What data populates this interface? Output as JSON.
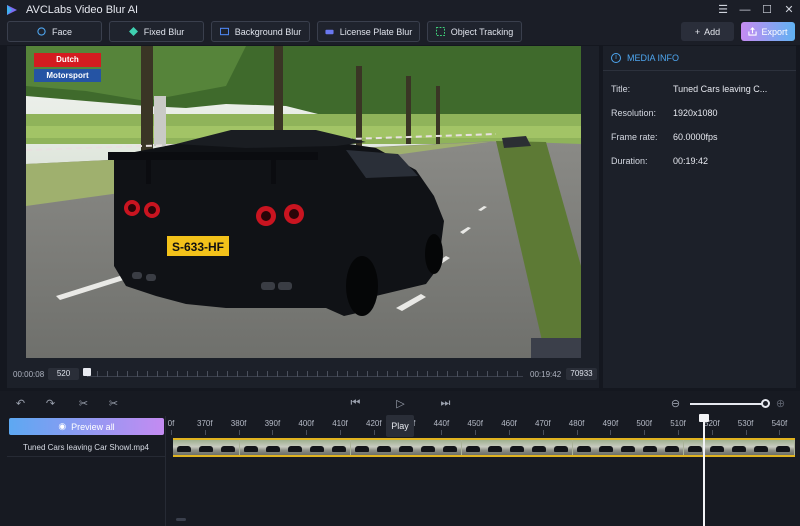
{
  "app": {
    "title": "AVCLabs Video Blur AI"
  },
  "window_controls": {
    "menu": "☰",
    "minimize": "—",
    "maximize": "☐",
    "close": "✕"
  },
  "toolbar": {
    "modes": [
      {
        "label": "Face",
        "icon": "face-icon"
      },
      {
        "label": "Fixed Blur",
        "icon": "fixed-blur-icon"
      },
      {
        "label": "Background Blur",
        "icon": "background-blur-icon"
      },
      {
        "label": "License Plate Blur",
        "icon": "license-plate-icon"
      },
      {
        "label": "Object Tracking",
        "icon": "object-tracking-icon"
      }
    ],
    "add_label": "Add",
    "export_label": "Export"
  },
  "video": {
    "logo_line1": "Dutch",
    "logo_line2": "Motorsport",
    "plate_text": "S-633-HF"
  },
  "scrubber": {
    "current_time": "00:00:08",
    "current_frame": "520",
    "end_time": "00:19:42",
    "end_frame": "70933",
    "progress": 0.007
  },
  "media_info": {
    "header": "MEDIA INFO",
    "rows": [
      {
        "label": "Title:",
        "value": "Tuned Cars leaving C..."
      },
      {
        "label": "Resolution:",
        "value": "1920x1080"
      },
      {
        "label": "Frame rate:",
        "value": "60.0000fps"
      },
      {
        "label": "Duration:",
        "value": "00:19:42"
      }
    ]
  },
  "timeline": {
    "preview_all_label": "Preview all",
    "clip_name": "Tuned Cars leaving Car Showl.mp4",
    "play_label": "Play",
    "ruler_labels": [
      "0f",
      "370f",
      "380f",
      "390f",
      "400f",
      "410f",
      "420f",
      "430f",
      "440f",
      "450f",
      "460f",
      "470f",
      "480f",
      "490f",
      "500f",
      "510f",
      "520f",
      "530f",
      "540f"
    ],
    "zoom_level": 0.95
  },
  "colors": {
    "accent_blue": "#4ea6f0",
    "export_gradient_start": "#c78bf2",
    "export_gradient_end": "#5fb2f2",
    "clip_border": "#e0b320",
    "logo_red": "#d41b20",
    "logo_blue": "#2554a4"
  }
}
